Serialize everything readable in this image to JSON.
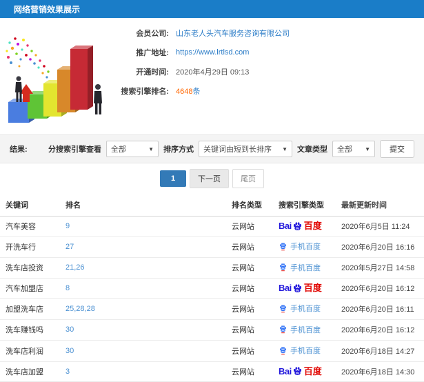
{
  "header": {
    "title": "网络营销效果展示"
  },
  "colors": {
    "header_bg": "#1a7dc8",
    "link": "#2b7cc7",
    "highlight": "#ff6600",
    "pagination_active": "#337ab7",
    "baidu_blue": "#2319dc",
    "baidu_red": "#e10602",
    "mobile_blue": "#4a90d2"
  },
  "illustration": {
    "name": "growth-bar-chart-with-businessmen",
    "bar_colors": [
      "#4a7de0",
      "#5fc436",
      "#e3e52f",
      "#d8882a",
      "#c62a35"
    ],
    "arrow_color": "#d62b1f"
  },
  "info": {
    "fields": [
      {
        "label": "会员公司:",
        "value": "山东老人头汽车服务咨询有限公司"
      },
      {
        "label": "推广地址:",
        "value": "https://www.lrtlsd.com"
      },
      {
        "label": "开通时间:",
        "value": "2020年4月29日 09:13"
      },
      {
        "label": "搜索引擎排名:",
        "value": "4648",
        "suffix": "条"
      }
    ]
  },
  "filters": {
    "result_label": "结果:",
    "engine_label": "分搜索引擎查看",
    "engine_value": "全部",
    "sort_label": "排序方式",
    "sort_value": "关键词由短到长排序",
    "article_label": "文章类型",
    "article_value": "全部",
    "submit_label": "提交",
    "caret": "▼"
  },
  "pagination": {
    "current": "1",
    "next_label": "下一页",
    "last_label": "尾页"
  },
  "engines": {
    "pc_prefix": "Bai",
    "pc_suffix": "百度",
    "paw_text": "du",
    "mobile_label": "手机百度"
  },
  "table": {
    "headers": [
      "关键词",
      "排名",
      "排名类型",
      "搜索引擎类型",
      "最新更新时间"
    ],
    "rows": [
      {
        "keyword": "汽车美容",
        "rank": "9",
        "rank_type": "云网站",
        "engine": "baidu-pc",
        "time": "2020年6月5日 11:24"
      },
      {
        "keyword": "开洗车行",
        "rank": "27",
        "rank_type": "云网站",
        "engine": "baidu-mobile",
        "time": "2020年6月20日 16:16"
      },
      {
        "keyword": "洗车店投资",
        "rank": "21,26",
        "rank_type": "云网站",
        "engine": "baidu-mobile",
        "time": "2020年5月27日 14:58"
      },
      {
        "keyword": "汽车加盟店",
        "rank": "8",
        "rank_type": "云网站",
        "engine": "baidu-pc",
        "time": "2020年6月20日 16:12"
      },
      {
        "keyword": "加盟洗车店",
        "rank": "25,28,28",
        "rank_type": "云网站",
        "engine": "baidu-mobile",
        "time": "2020年6月20日 16:11"
      },
      {
        "keyword": "洗车赚钱吗",
        "rank": "30",
        "rank_type": "云网站",
        "engine": "baidu-mobile",
        "time": "2020年6月20日 16:12"
      },
      {
        "keyword": "洗车店利润",
        "rank": "30",
        "rank_type": "云网站",
        "engine": "baidu-mobile",
        "time": "2020年6月18日 14:27"
      },
      {
        "keyword": "洗车店加盟",
        "rank": "3",
        "rank_type": "云网站",
        "engine": "baidu-pc",
        "time": "2020年6月18日 14:30"
      }
    ]
  }
}
